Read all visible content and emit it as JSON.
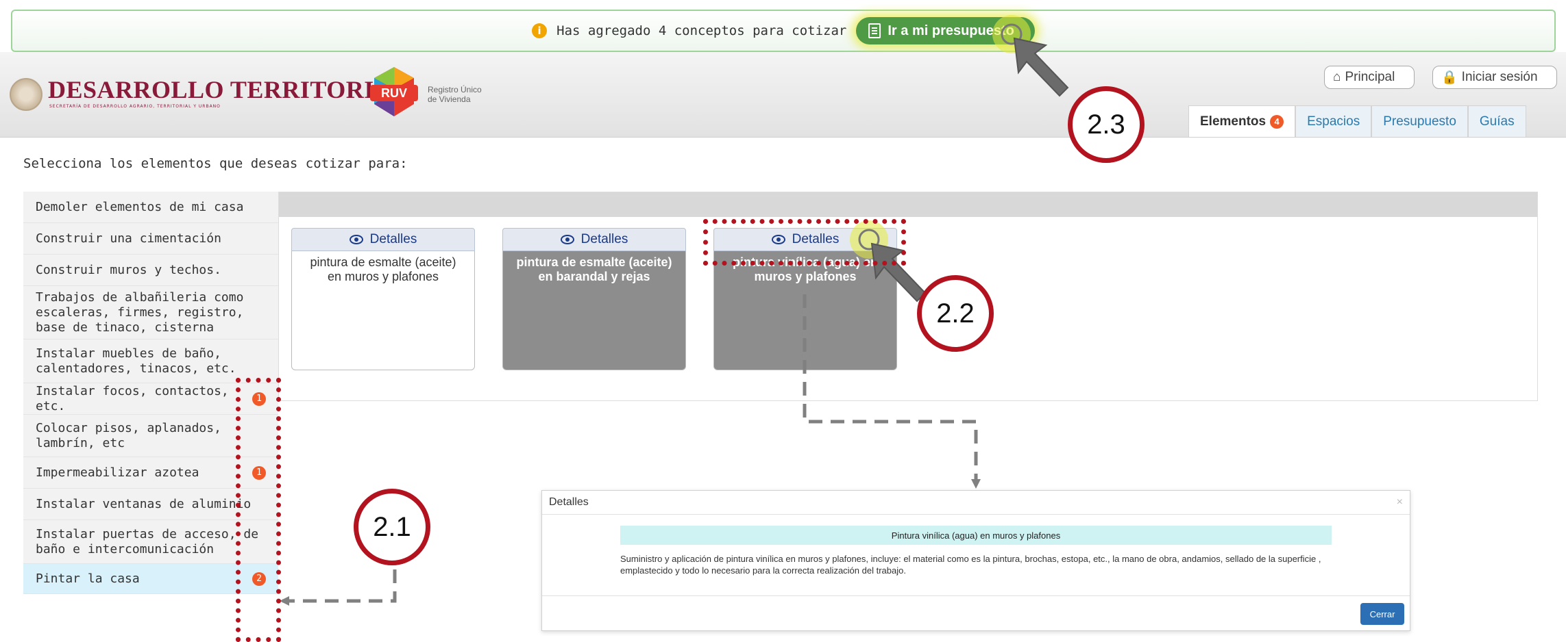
{
  "notice": {
    "message": "Has agregado 4 conceptos para cotizar",
    "button_label": "Ir a mi presupuesto"
  },
  "header": {
    "brand_title": "DESARROLLO TERRITORIAL",
    "brand_subtitle": "SECRETARÍA DE DESARROLLO AGRARIO, TERRITORIAL Y URBANO",
    "ruv_logo_text": "RUV",
    "ruv_caption_line1": "Registro Único",
    "ruv_caption_line2": "de Vivienda",
    "principal_label": "Principal",
    "login_label": "Iniciar sesión"
  },
  "tabs": [
    {
      "label": "Elementos",
      "badge": "4"
    },
    {
      "label": "Espacios"
    },
    {
      "label": "Presupuesto"
    },
    {
      "label": "Guías"
    }
  ],
  "prompt": "Selecciona los elementos que deseas cotizar para:",
  "categories": [
    {
      "label": "Demoler elementos de mi casa"
    },
    {
      "label": "Construir una cimentación"
    },
    {
      "label": "Construir muros y techos."
    },
    {
      "label": "Trabajos de albañileria como escaleras, firmes, registro, base de tinaco, cisterna"
    },
    {
      "label": "Instalar muebles de baño, calentadores, tinacos, etc."
    },
    {
      "label": "Instalar focos, contactos, etc.",
      "count": "1"
    },
    {
      "label": "Colocar pisos, aplanados, lambrín, etc"
    },
    {
      "label": "Impermeabilizar azotea",
      "count": "1"
    },
    {
      "label": "Instalar ventanas de aluminio"
    },
    {
      "label": "Instalar puertas de acceso, de baño e intercomunicación"
    },
    {
      "label": "Pintar la casa",
      "count": "2"
    }
  ],
  "cards": [
    {
      "details_label": "Detalles",
      "text": "pintura de esmalte (aceite) en muros y plafones"
    },
    {
      "details_label": "Detalles",
      "text": "pintura de esmalte (aceite) en barandal y rejas"
    },
    {
      "details_label": "Detalles",
      "text": "pintura vinílica (agua) en muros y plafones"
    }
  ],
  "modal": {
    "header": "Detalles",
    "close_x": "×",
    "title": "Pintura vinílica (agua) en muros y plafones",
    "description": "Suministro y aplicación de pintura vinílica en muros y plafones, incluye: el material como es la pintura, brochas, estopa, etc., la mano de obra, andamios, sellado de la superficie , emplastecido y todo lo necesario para la correcta realización del trabajo.",
    "close_button": "Cerrar"
  },
  "annotations": {
    "step_1": "2.1",
    "step_2": "2.2",
    "step_3": "2.3"
  },
  "colors": {
    "accent_red": "#b3131f",
    "badge_orange": "#f05a28",
    "go_button_green": "#4f9a45",
    "brand_maroon": "#8a1a3a",
    "active_tab_link": "#2a7ab0",
    "active_category_bg": "#d8f1fb"
  }
}
